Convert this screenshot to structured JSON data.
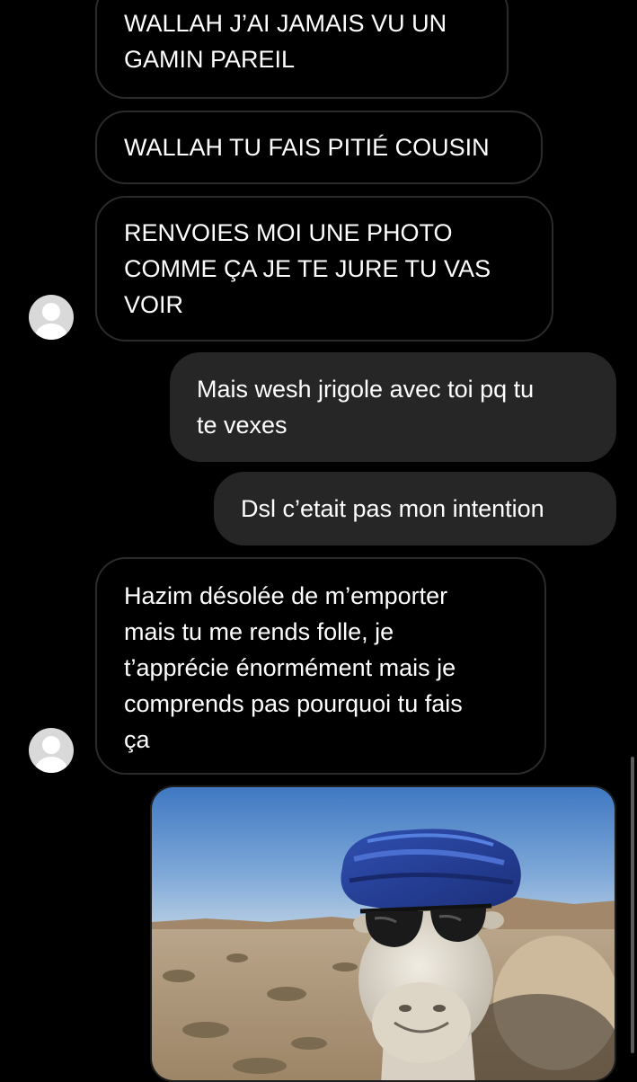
{
  "messages": [
    {
      "direction": "incoming",
      "lines": [
        "WALLAH J’AI JAMAIS VU UN",
        "GAMIN PAREIL"
      ]
    },
    {
      "direction": "incoming",
      "lines": [
        "WALLAH TU FAIS PITIÉ COUSIN"
      ]
    },
    {
      "direction": "incoming",
      "lines": [
        "RENVOIES MOI UNE PHOTO",
        "COMME ÇA JE TE JURE TU VAS",
        "VOIR"
      ]
    },
    {
      "direction": "outgoing",
      "lines": [
        "Mais wesh jrigole avec toi pq tu",
        "te vexes"
      ]
    },
    {
      "direction": "outgoing",
      "lines": [
        "Dsl c’etait pas mon intention"
      ]
    },
    {
      "direction": "incoming",
      "lines": [
        "Hazim désolée de m’emporter",
        "mais tu me rends folle, je",
        "t’apprécie énormément mais je",
        "comprends pas pourquoi tu fais",
        "ça"
      ]
    }
  ],
  "photo": {
    "subject": "camel-with-blue-turban-and-sunglasses"
  },
  "icons": {
    "avatar": "default-avatar-icon"
  },
  "colors": {
    "background": "#000000",
    "outgoing_bubble": "#262626",
    "incoming_border": "#2b2b2b"
  }
}
